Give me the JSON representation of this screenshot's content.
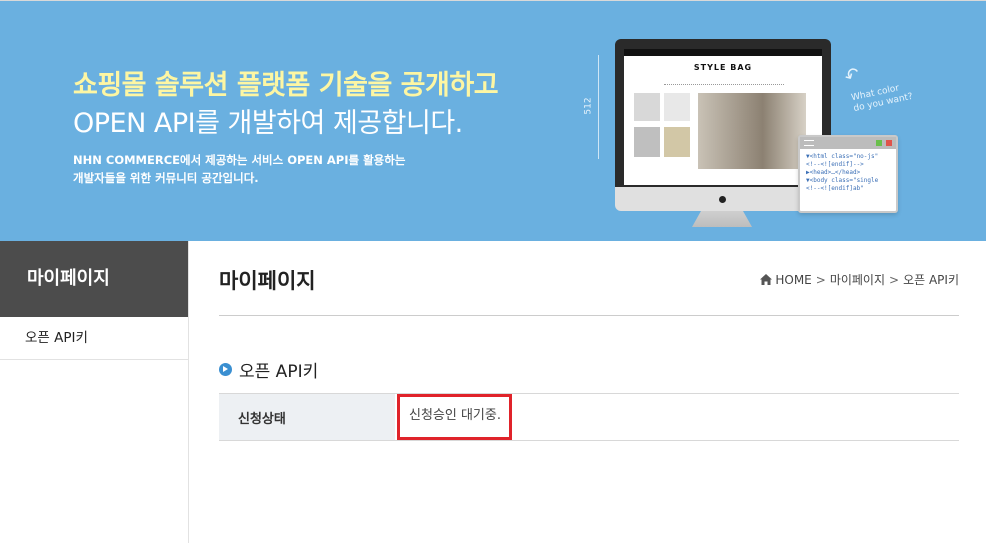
{
  "hero": {
    "title_line1": "쇼핑몰 솔루션 플랫폼 기술을 공개하고",
    "title_line2": "OPEN API를 개발하여 제공합니다.",
    "desc_line1": "NHN COMMERCE에서 제공하는 서비스 OPEN API를 활용하는",
    "desc_line2": "개발자들을 위한 커뮤니티 공간입니다.",
    "illustration": {
      "ruler_label": "512",
      "screen_brand": "STYLE BAG",
      "note": "What color\ndo you want?",
      "code_lines": [
        "▼<html class=\"no-js\"",
        "  <!--<![endif]-->",
        " ▶<head>…</head>",
        " ▼<body class=\"single",
        "  <!--<![endif]ab\""
      ]
    }
  },
  "sidebar": {
    "heading": "마이페이지",
    "items": [
      {
        "label": "오픈 API키"
      }
    ]
  },
  "main": {
    "page_title": "마이페이지",
    "breadcrumb": [
      "HOME",
      "마이페이지",
      "오픈 API키"
    ],
    "breadcrumb_separator": ">",
    "section_title": "오픈 API키",
    "table": {
      "label": "신청상태",
      "value": "신청승인 대기중."
    }
  },
  "colors": {
    "hero_bg": "#6ab0e0",
    "hero_title_accent": "#fdf6a3",
    "sidebar_head_bg": "#4c4c4c",
    "highlight_border": "#e0232a",
    "bullet": "#3a8fd1"
  },
  "icons": {
    "breadcrumb_home": "home-icon",
    "section_bullet": "circle-arrow-right-icon"
  }
}
